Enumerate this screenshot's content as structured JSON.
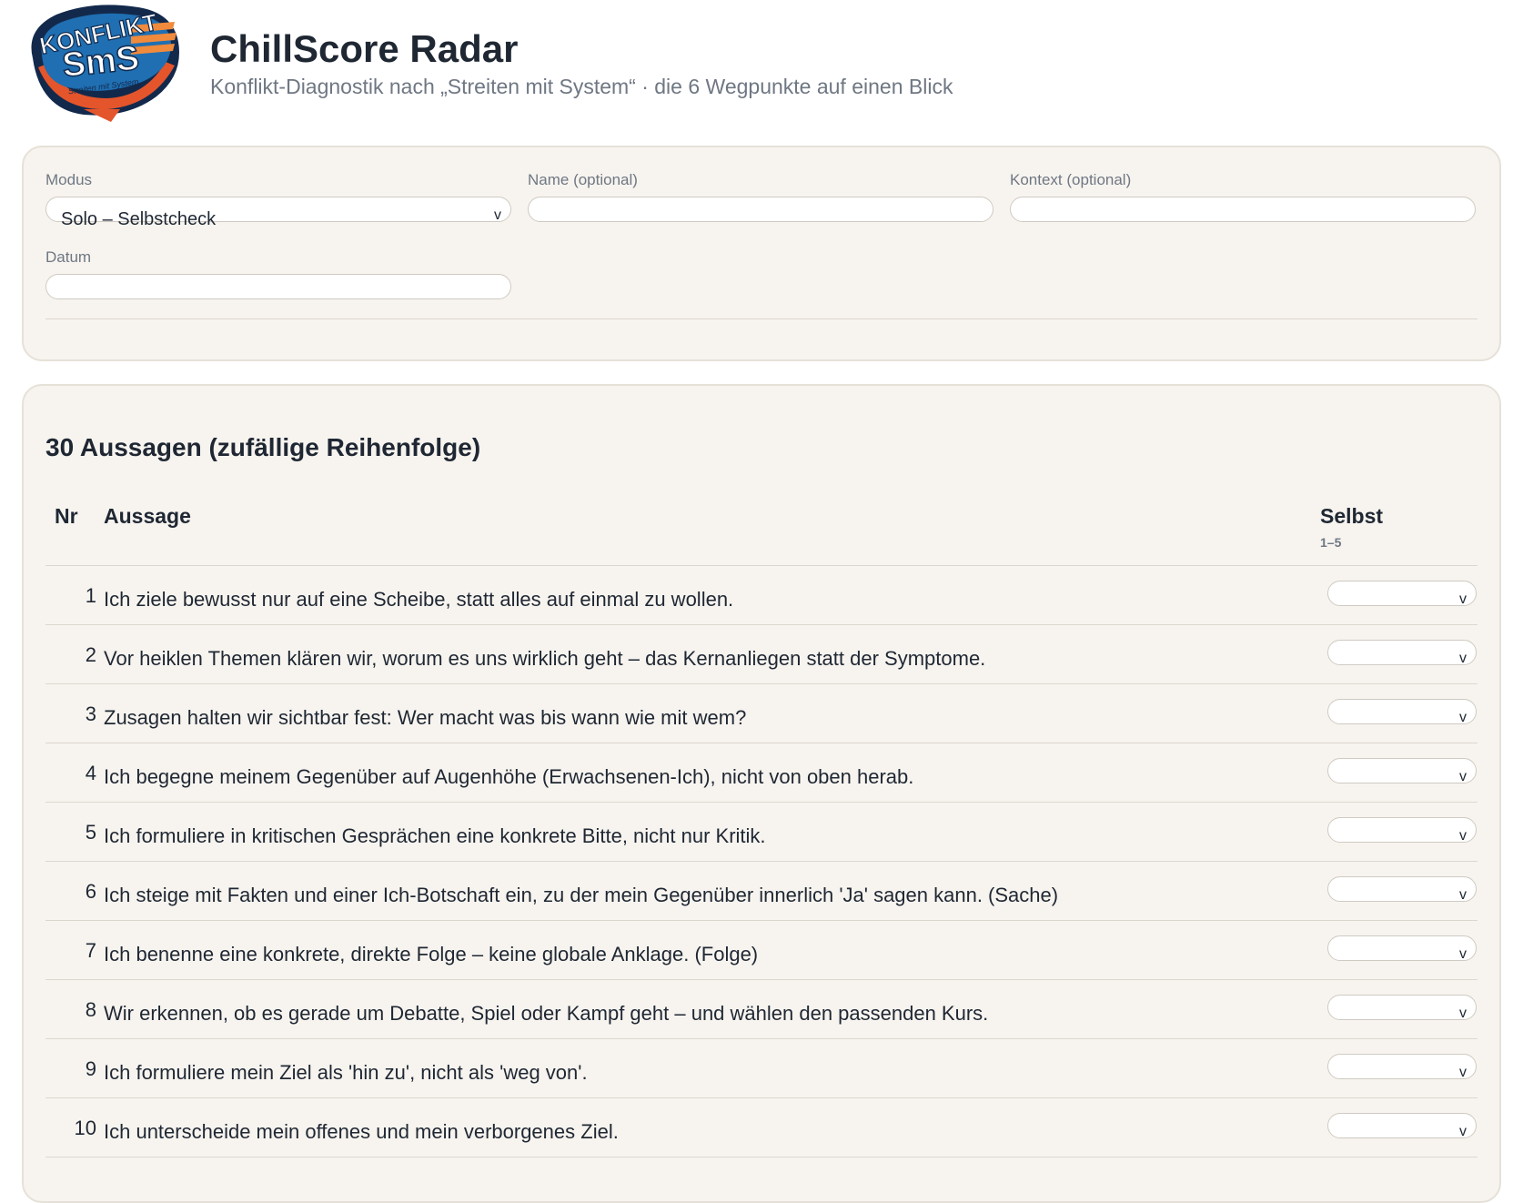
{
  "header": {
    "logo": {
      "line1": "KONFLIKT",
      "line2": "SmS",
      "tagline": "Streiten mit System"
    },
    "title": "ChillScore Radar",
    "subtitle": "Konflikt-Diagnostik nach „Streiten mit System“ · die 6 Wegpunkte auf einen Blick"
  },
  "settings": {
    "modus": {
      "label": "Modus",
      "value": "Solo – Selbstcheck"
    },
    "name": {
      "label": "Name (optional)",
      "value": ""
    },
    "kontext": {
      "label": "Kontext (optional)",
      "value": ""
    },
    "datum": {
      "label": "Datum",
      "value": ""
    }
  },
  "statements": {
    "title": "30 Aussagen (zufällige Reihenfolge)",
    "columns": {
      "nr": "Nr",
      "aussage": "Aussage",
      "selbst": "Selbst",
      "selbst_range": "1–5"
    },
    "rows": [
      {
        "nr": "1",
        "text": "Ich ziele bewusst nur auf eine Scheibe, statt alles auf einmal zu wollen.",
        "value": ""
      },
      {
        "nr": "2",
        "text": "Vor heiklen Themen klären wir, worum es uns wirklich geht – das Kernanliegen statt der Symptome.",
        "value": ""
      },
      {
        "nr": "3",
        "text": "Zusagen halten wir sichtbar fest: Wer macht was bis wann wie mit wem?",
        "value": ""
      },
      {
        "nr": "4",
        "text": "Ich begegne meinem Gegenüber auf Augenhöhe (Erwachsenen-Ich), nicht von oben herab.",
        "value": ""
      },
      {
        "nr": "5",
        "text": "Ich formuliere in kritischen Gesprächen eine konkrete Bitte, nicht nur Kritik.",
        "value": ""
      },
      {
        "nr": "6",
        "text": "Ich steige mit Fakten und einer Ich-Botschaft ein, zu der mein Gegenüber innerlich 'Ja' sagen kann. (Sache)",
        "value": ""
      },
      {
        "nr": "7",
        "text": "Ich benenne eine konkrete, direkte Folge – keine globale Anklage. (Folge)",
        "value": ""
      },
      {
        "nr": "8",
        "text": "Wir erkennen, ob es gerade um Debatte, Spiel oder Kampf geht – und wählen den passenden Kurs.",
        "value": ""
      },
      {
        "nr": "9",
        "text": "Ich formuliere mein Ziel als 'hin zu', nicht als 'weg von'.",
        "value": ""
      },
      {
        "nr": "10",
        "text": "Ich unterscheide mein offenes und mein verborgenes Ziel.",
        "value": ""
      }
    ]
  },
  "icons": {
    "select_caret": "chevron-down-icon"
  },
  "colors": {
    "card_bg": "#f7f4ef",
    "logo_orange": "#e4552b",
    "logo_blue": "#1f6fb2",
    "logo_navy": "#13294b"
  }
}
